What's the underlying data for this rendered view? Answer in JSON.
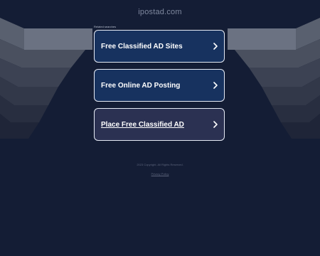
{
  "header": {
    "domain": "ipostad.com"
  },
  "related": {
    "label": "Related searches"
  },
  "links": [
    {
      "label": "Free Classified AD Sites"
    },
    {
      "label": "Free Online AD Posting"
    },
    {
      "label": "Place Free Classified AD"
    }
  ],
  "footer": {
    "copyright": "2023 Copyright. All Rights Reserved.",
    "privacy": "Privacy Policy"
  },
  "colors": {
    "background": "#141d35",
    "card": "#17325f",
    "card_hover": "#2b3152",
    "card_border": "#e6ebf5"
  },
  "icons": {
    "card_arrow": "chevron-right-icon"
  }
}
